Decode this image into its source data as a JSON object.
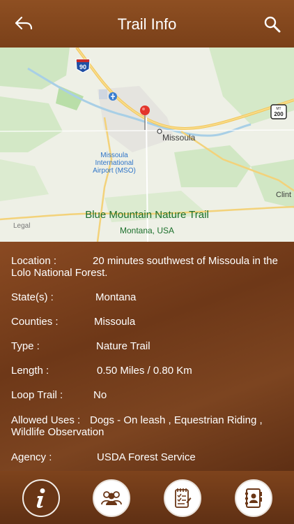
{
  "header": {
    "title": "Trail Info",
    "back_icon": "back-arrow-icon",
    "search_icon": "search-icon"
  },
  "map": {
    "interstate_shield": "90",
    "state_shield_top": "MT",
    "state_shield_number": "200",
    "airport_label": "Missoula International Airport (MSO)",
    "city_label": "Missoula",
    "edge_city_label": "Clint",
    "legal_label": "Legal",
    "trail_name": "Blue Mountain Nature Trail",
    "trail_location": "Montana, USA",
    "pin_color": "#e3352c"
  },
  "details": {
    "location_label": "Location  :",
    "location_value": "20 minutes southwest of Missoula in the",
    "location_value_cont": "Lolo National Forest.",
    "states_label": "State(s)  :",
    "states_value": "Montana",
    "counties_label": "Counties  :",
    "counties_value": "Missoula",
    "type_label": "Type  :",
    "type_value": "Nature Trail",
    "length_label": "Length  :",
    "length_value": "0.50 Miles / 0.80 Km",
    "loop_label": "Loop Trail  :",
    "loop_value": "No",
    "uses_label": "Allowed Uses  :",
    "uses_value": "Dogs - On leash , Equestrian  Riding ,",
    "uses_value_cont": "Wildlife Observation",
    "agency_label": "Agency  :",
    "agency_value": "USDA Forest Service"
  },
  "tabbar": {
    "tabs": [
      {
        "icon": "info-icon",
        "active": true
      },
      {
        "icon": "people-icon",
        "active": false
      },
      {
        "icon": "checklist-icon",
        "active": false
      },
      {
        "icon": "contacts-book-icon",
        "active": false
      }
    ],
    "accent": "#6a3616"
  }
}
